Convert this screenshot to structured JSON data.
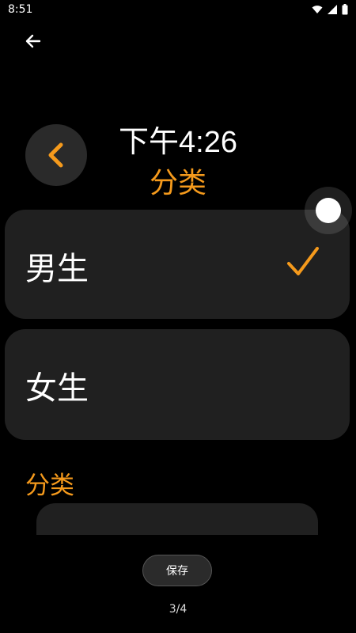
{
  "status_bar": {
    "time": "8:51"
  },
  "preview": {
    "time": "下午4:26",
    "title": "分类"
  },
  "options": [
    {
      "label": "男生",
      "selected": true
    },
    {
      "label": "女生",
      "selected": false
    }
  ],
  "section": {
    "title": "分类"
  },
  "footer": {
    "save_label": "保存",
    "page_indicator": "3/4"
  },
  "colors": {
    "accent": "#f59a1c",
    "card": "#202020",
    "background": "#000000"
  },
  "icons": [
    "back-arrow-icon",
    "chevron-left-icon",
    "check-icon",
    "wifi-icon",
    "signal-icon",
    "battery-icon"
  ]
}
